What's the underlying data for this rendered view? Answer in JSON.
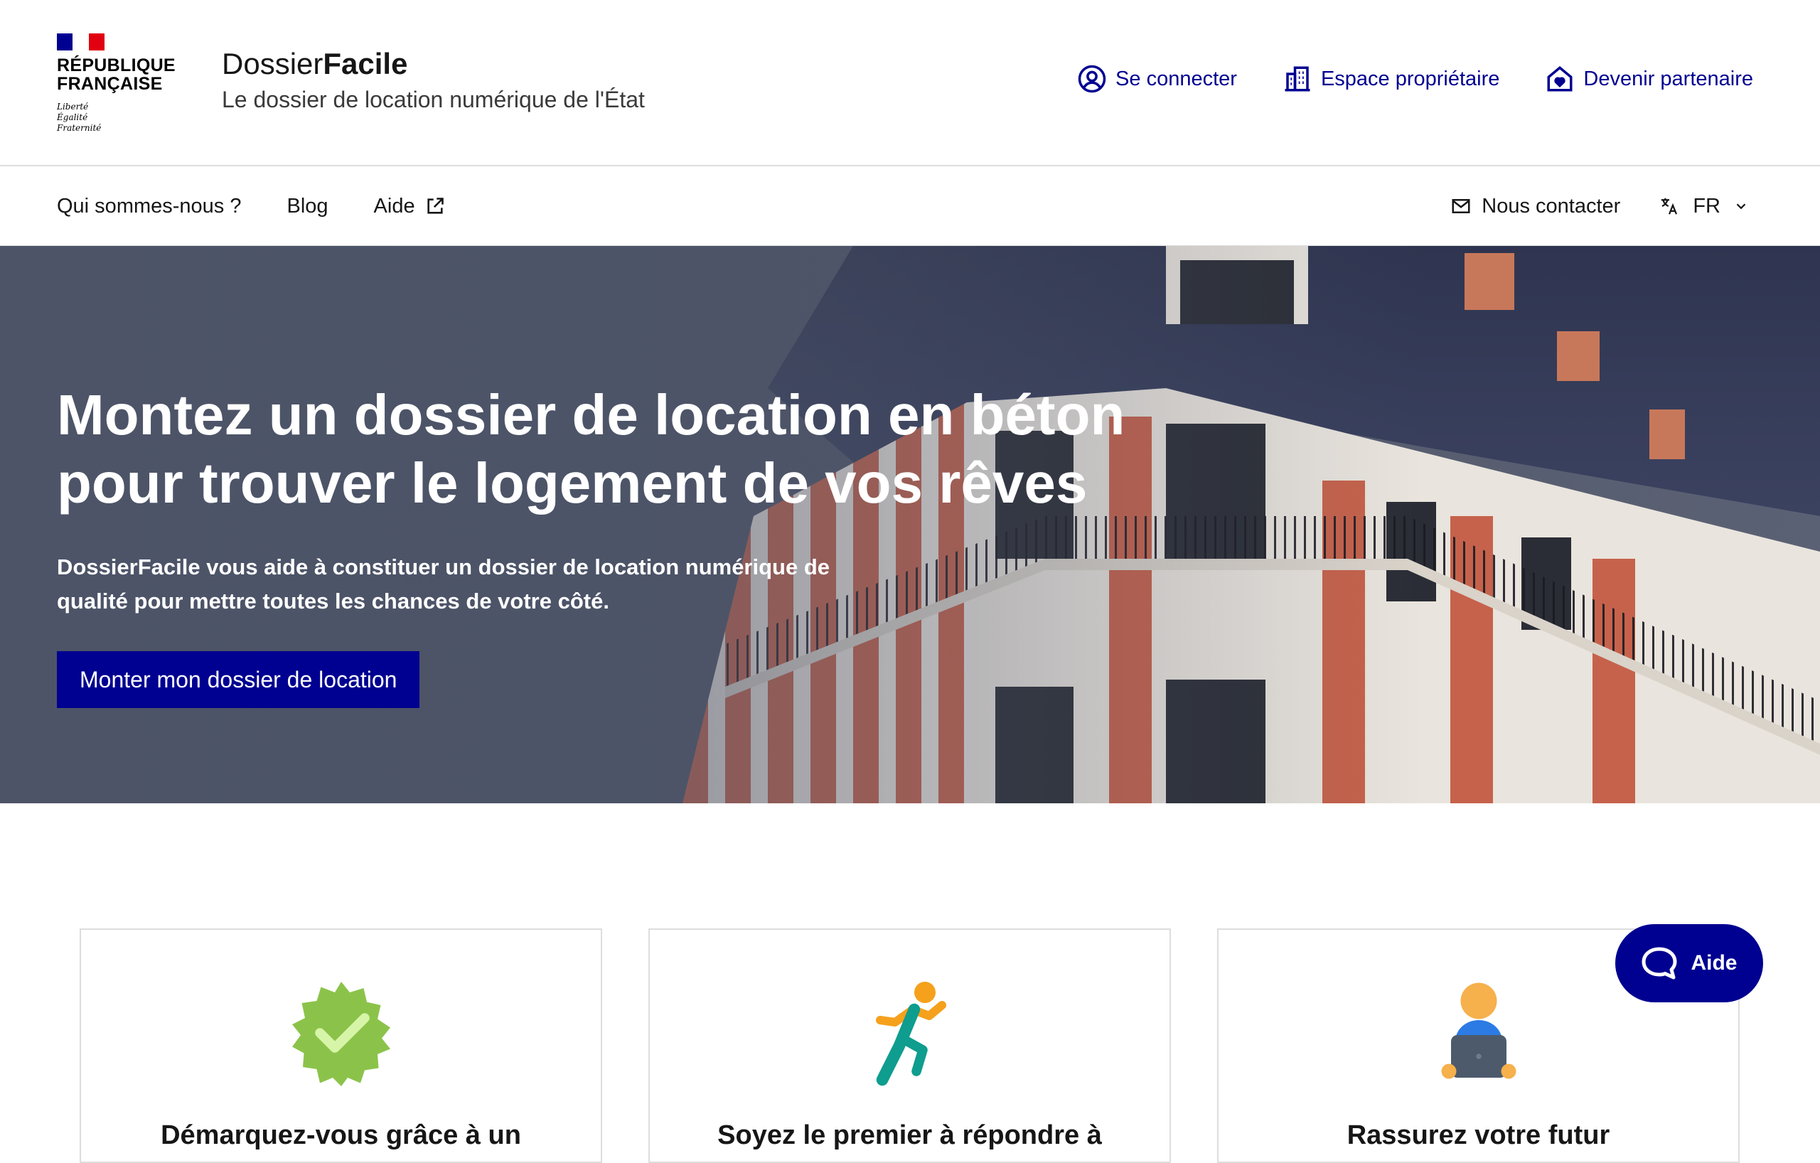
{
  "header": {
    "marianne": {
      "name": "RÉPUBLIQUE\nFRANÇAISE",
      "motto": "Liberté\nÉgalité\nFraternité",
      "flag_colors": [
        "#000091",
        "#ffffff",
        "#e1000f"
      ]
    },
    "service_title_prefix": "Dossier",
    "service_title_bold": "Facile",
    "service_tagline": "Le dossier de location numérique de l'État",
    "tools": [
      {
        "label": "Se connecter",
        "icon": "user-circle-icon"
      },
      {
        "label": "Espace propriétaire",
        "icon": "building-icon"
      },
      {
        "label": "Devenir partenaire",
        "icon": "home-heart-icon"
      }
    ]
  },
  "nav": {
    "items": [
      {
        "label": "Qui sommes-nous ?"
      },
      {
        "label": "Blog"
      },
      {
        "label": "Aide",
        "icon": "external-link-icon"
      }
    ],
    "contact_label": "Nous contacter",
    "contact_icon": "mail-icon",
    "language": "FR",
    "language_icon": "translate-icon"
  },
  "hero": {
    "title": "Montez un dossier de location en béton\npour trouver le logement de vos rêves",
    "text": "DossierFacile vous aide à constituer un dossier de location numérique de qualité pour mettre toutes les chances de votre côté.",
    "cta": "Monter mon dossier de location"
  },
  "cards": [
    {
      "title": "Démarquez-vous grâce à un",
      "icon": "verified-badge-icon"
    },
    {
      "title": "Soyez le premier à répondre à",
      "icon": "running-person-icon"
    },
    {
      "title": "Rassurez votre futur",
      "icon": "person-laptop-icon"
    }
  ],
  "help_button": {
    "label": "Aide",
    "icon": "chat-bubble-icon"
  },
  "colors": {
    "primary": "#000091",
    "text": "#161616",
    "border": "#dddddd",
    "badge_green": "#8bc34a",
    "runner_orange": "#f5a11c",
    "runner_teal": "#0e9d8e",
    "avatar_orange": "#f6b04c",
    "avatar_blue": "#2c7be5"
  }
}
